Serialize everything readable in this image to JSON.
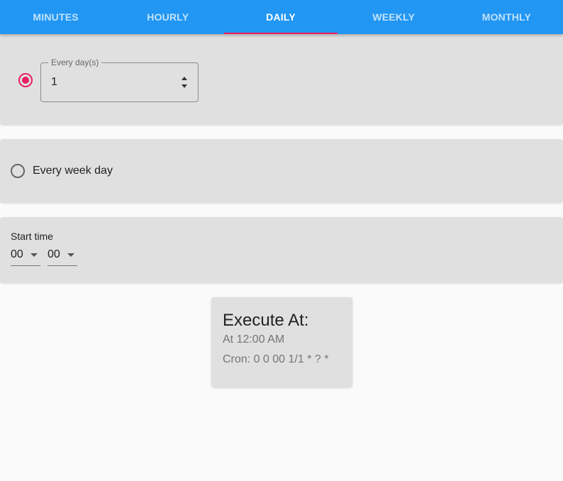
{
  "tabs": [
    {
      "label": "MINUTES",
      "active": false
    },
    {
      "label": "HOURLY",
      "active": false
    },
    {
      "label": "DAILY",
      "active": true
    },
    {
      "label": "WEEKLY",
      "active": false
    },
    {
      "label": "MONTHLY",
      "active": false
    }
  ],
  "every_days": {
    "selected": true,
    "field_label": "Every day(s)",
    "value": "1"
  },
  "every_week_day": {
    "selected": false,
    "label": "Every week day"
  },
  "start_time": {
    "label": "Start time",
    "hour": "00",
    "minute": "00"
  },
  "execute": {
    "title": "Execute At:",
    "description": "At 12:00 AM",
    "cron": "Cron: 0 0 00 1/1 * ? *"
  },
  "colors": {
    "primary": "#2196f3",
    "accent": "#e91e63",
    "panel": "#e0e0e0"
  }
}
